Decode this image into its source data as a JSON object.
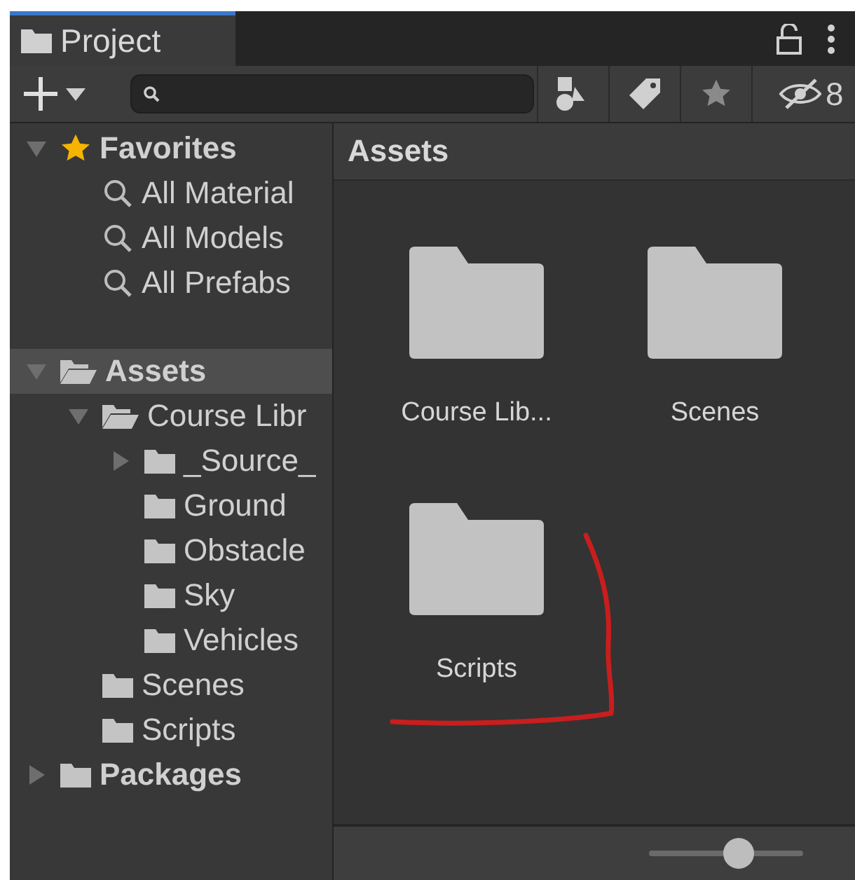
{
  "tab": {
    "label": "Project",
    "selected": true
  },
  "toolbar": {
    "hidden_count": "8"
  },
  "tree": [
    {
      "label": "Favorites",
      "kind": "favorites",
      "expanded": true,
      "selected": false,
      "children": [
        {
          "label": "All Material",
          "kind": "search",
          "selected": false
        },
        {
          "label": "All Models",
          "kind": "search",
          "selected": false
        },
        {
          "label": "All Prefabs",
          "kind": "search",
          "selected": false
        }
      ]
    },
    {
      "label": "Assets",
      "kind": "folder",
      "expanded": true,
      "selected": true,
      "children": [
        {
          "label": "Course Libr",
          "kind": "folder",
          "expanded": true,
          "selected": false,
          "children": [
            {
              "label": "_Source_",
              "kind": "folder",
              "expanded": false,
              "selected": false
            },
            {
              "label": "Ground",
              "kind": "folder",
              "selected": false
            },
            {
              "label": "Obstacle",
              "kind": "folder",
              "selected": false
            },
            {
              "label": "Sky",
              "kind": "folder",
              "selected": false
            },
            {
              "label": "Vehicles",
              "kind": "folder",
              "selected": false
            }
          ]
        },
        {
          "label": "Scenes",
          "kind": "folder",
          "selected": false
        },
        {
          "label": "Scripts",
          "kind": "folder",
          "selected": false
        }
      ]
    },
    {
      "label": "Packages",
      "kind": "folder",
      "expanded": false,
      "selected": false
    }
  ],
  "content": {
    "title": "Assets",
    "items": [
      {
        "label": "Course Lib...",
        "kind": "folder"
      },
      {
        "label": "Scenes",
        "kind": "folder"
      },
      {
        "label": "Scripts",
        "kind": "folder"
      }
    ]
  },
  "markup": [
    {
      "kind": "pen_stroke"
    }
  ],
  "zoom_slider": {
    "level": 0.58
  }
}
